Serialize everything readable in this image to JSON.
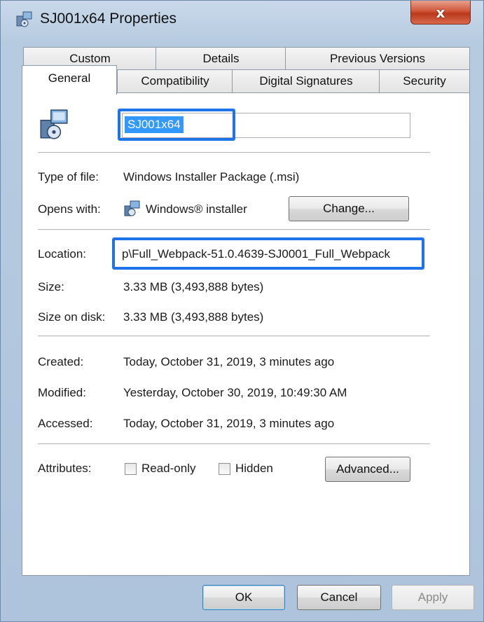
{
  "window": {
    "title": "SJ001x64 Properties",
    "close_glyph": "x"
  },
  "tabs": {
    "row1": [
      "Custom",
      "Details",
      "Previous Versions"
    ],
    "row2": [
      "General",
      "Compatibility",
      "Digital Signatures",
      "Security"
    ],
    "active": "General"
  },
  "general": {
    "file_name": "SJ001x64",
    "type_label": "Type of file:",
    "type_value": "Windows Installer Package (.msi)",
    "opens_label": "Opens with:",
    "opens_value": "Windows® installer",
    "change_button": "Change...",
    "location_label": "Location:",
    "location_value": "p\\Full_Webpack-51.0.4639-SJ0001_Full_Webpack",
    "size_label": "Size:",
    "size_value": "3.33 MB (3,493,888 bytes)",
    "size_disk_label": "Size on disk:",
    "size_disk_value": "3.33 MB (3,493,888 bytes)",
    "created_label": "Created:",
    "created_value": "Today, October 31, 2019, 3 minutes ago",
    "modified_label": "Modified:",
    "modified_value": "Yesterday, October 30, 2019, 10:49:30 AM",
    "accessed_label": "Accessed:",
    "accessed_value": "Today, October 31, 2019, 3 minutes ago",
    "attributes_label": "Attributes:",
    "readonly_label": "Read-only",
    "readonly_checked": false,
    "hidden_label": "Hidden",
    "hidden_checked": false,
    "advanced_button": "Advanced..."
  },
  "footer": {
    "ok": "OK",
    "cancel": "Cancel",
    "apply": "Apply"
  },
  "colors": {
    "highlight_box": "#1e73e8",
    "selection": "#3399ff",
    "close_button": "#c9472a"
  },
  "icons": [
    "installer-package-icon",
    "windows-installer-icon",
    "close-icon"
  ]
}
